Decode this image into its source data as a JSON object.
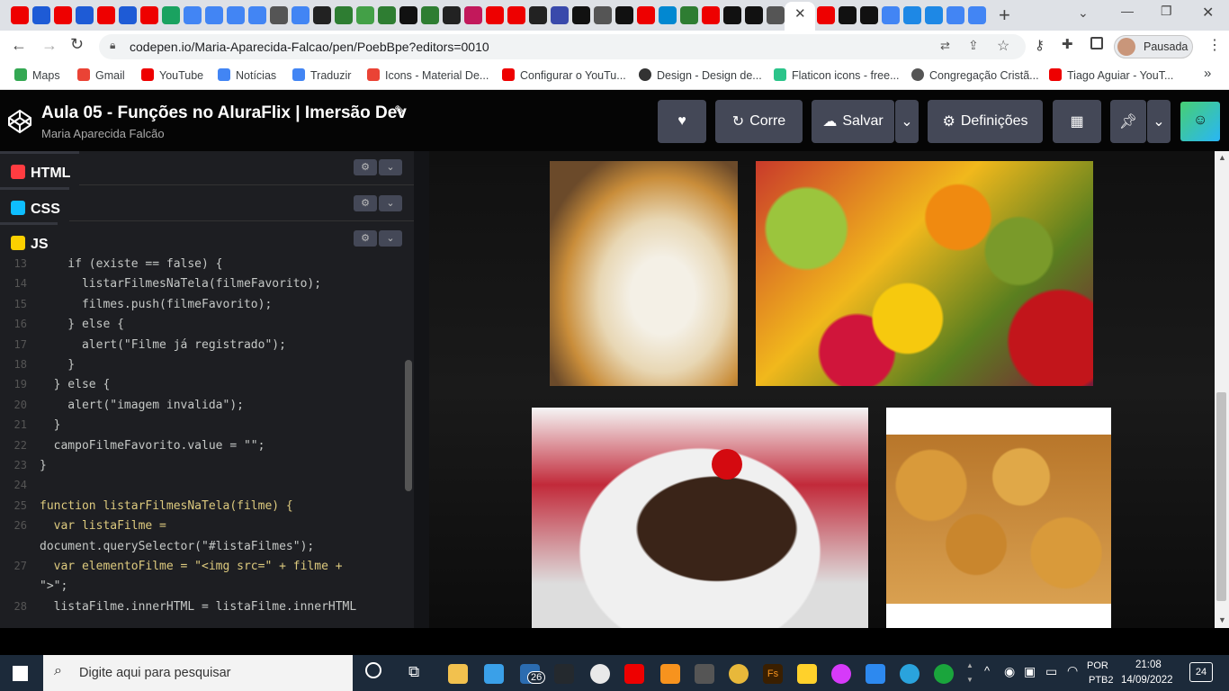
{
  "browser": {
    "url": "codepen.io/Maria-Aparecida-Falcao/pen/PoebBpe?editors=0010",
    "profile_label": "Pausada",
    "bookmarks": [
      "Maps",
      "Gmail",
      "YouTube",
      "Notícias",
      "Traduzir",
      "Icons - Material De...",
      "Configurar o YouTu...",
      "Design - Design de...",
      "Flaticon icons - free...",
      "Congregação Cristã...",
      "Tiago Aguiar - YouT..."
    ]
  },
  "codepen": {
    "title": "Aula 05 - Funções no AluraFlix | Imersão Dev",
    "author": "Maria Aparecida Falcão",
    "run_label": "Corre",
    "save_label": "Salvar",
    "settings_label": "Definições"
  },
  "editor": {
    "panels": [
      "HTML",
      "CSS",
      "JS"
    ],
    "lines": [
      {
        "n": "13",
        "text": "    if (existe == false) {"
      },
      {
        "n": "14",
        "text": "      listarFilmesNaTela(filmeFavorito);"
      },
      {
        "n": "15",
        "text": "      filmes.push(filmeFavorito);"
      },
      {
        "n": "16",
        "text": "    } else {"
      },
      {
        "n": "17",
        "text": "      alert(\"Filme já registrado\");"
      },
      {
        "n": "18",
        "text": "    }"
      },
      {
        "n": "19",
        "text": "  } else {"
      },
      {
        "n": "20",
        "text": "    alert(\"imagem invalida\");"
      },
      {
        "n": "21",
        "text": "  }"
      },
      {
        "n": "22",
        "text": "  campoFilmeFavorito.value = \"\";"
      },
      {
        "n": "23",
        "text": "}"
      },
      {
        "n": "24",
        "text": ""
      },
      {
        "n": "25",
        "text": "function listarFilmesNaTela(filme) {"
      },
      {
        "n": "26",
        "text": "  var listaFilme ="
      },
      {
        "n": "",
        "text": "document.querySelector(\"#listaFilmes\");"
      },
      {
        "n": "27",
        "text": "  var elementoFilme = \"<img src=\" + filme +"
      },
      {
        "n": "",
        "text": "\">\";"
      },
      {
        "n": "28",
        "text": "  listaFilme.innerHTML = listaFilme.innerHTML"
      }
    ]
  },
  "taskbar": {
    "search_placeholder": "Digite aqui para pesquisar",
    "lang": "POR",
    "layout": "PTB2",
    "time": "21:08",
    "date": "14/09/2022",
    "notif_count": "24",
    "mail_badge": "26"
  }
}
